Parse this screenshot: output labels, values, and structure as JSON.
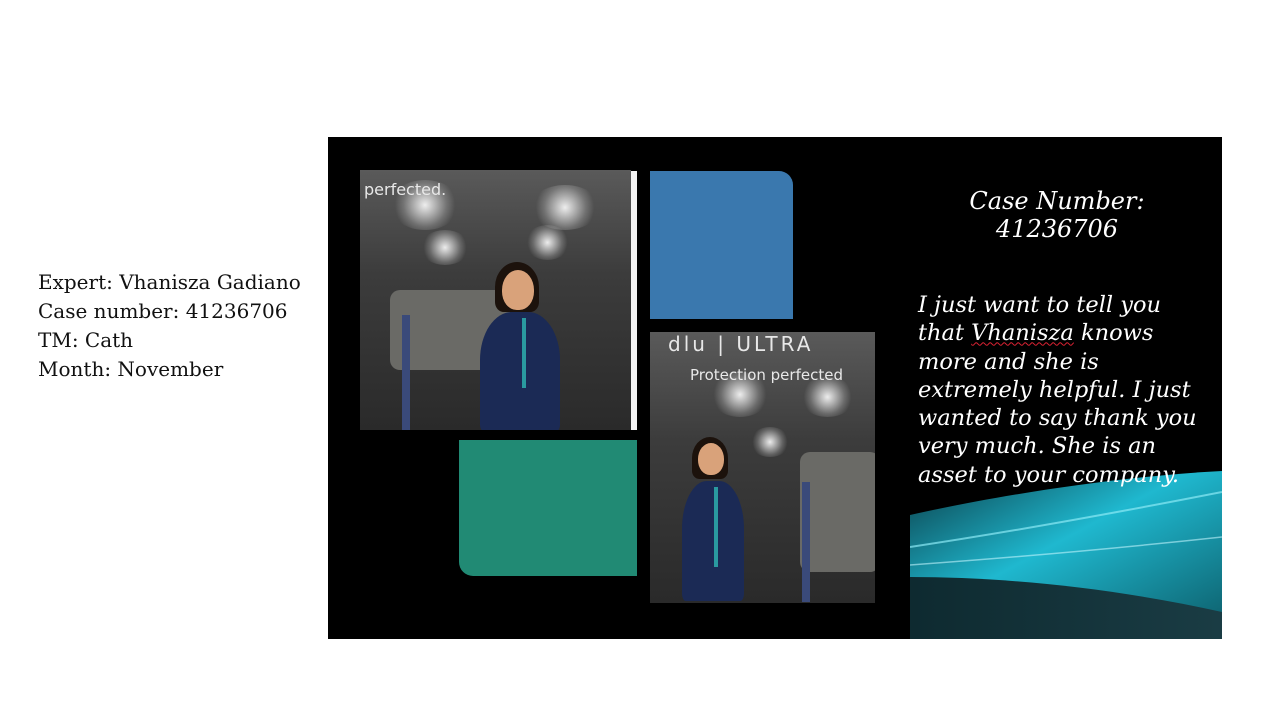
{
  "info": {
    "expert": "Expert: Vhanisza Gadiano",
    "case_number": "Case number: 41236706",
    "tm": "TM: Cath",
    "month": "Month: November"
  },
  "slide": {
    "photo1_wall_text": "perfected.",
    "photo2_wall_text_top": "dlu  |  ULTRA",
    "photo2_wall_text": "Protection perfected",
    "case_title_line1": "Case Number:",
    "case_title_line2": "41236706",
    "quote_before": "I just want to tell you that ",
    "quote_name": "Vhanisza",
    "quote_after": " knows more and she is extremely helpful. I just wanted to say thank you very much. She is an asset to your company."
  },
  "colors": {
    "slide_bg": "#000000",
    "blue_block": "#3a78ae",
    "green_block": "#218a74",
    "wave": "#1ab3c9"
  }
}
